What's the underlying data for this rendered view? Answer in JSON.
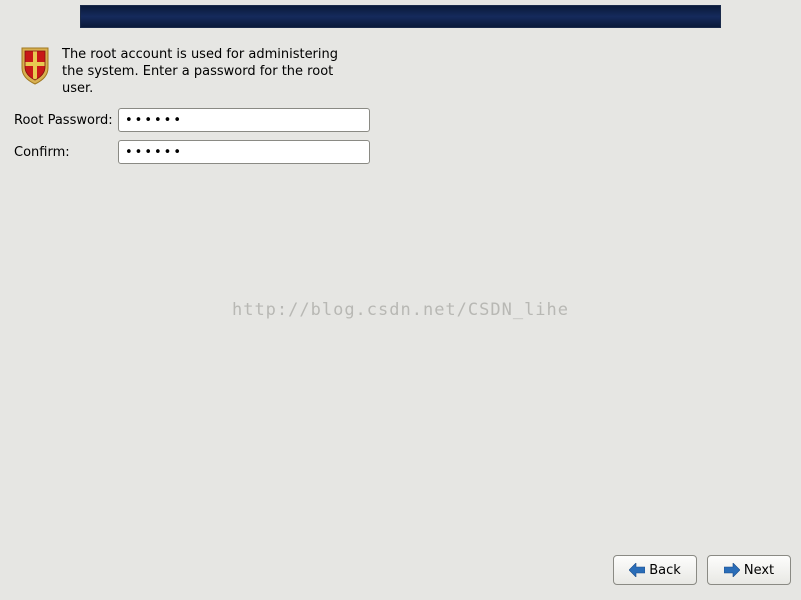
{
  "intro": {
    "text": "The root account is used for administering the system.  Enter a password for the root user."
  },
  "form": {
    "password_label": "Root Password:",
    "password_value": "••••••",
    "confirm_label": "Confirm:",
    "confirm_value": "••••••"
  },
  "buttons": {
    "back": "Back",
    "next": "Next"
  },
  "watermark": "http://blog.csdn.net/CSDN_lihe",
  "colors": {
    "banner": "#152a5c",
    "bg": "#e6e6e3",
    "arrow": "#2a6db8"
  }
}
